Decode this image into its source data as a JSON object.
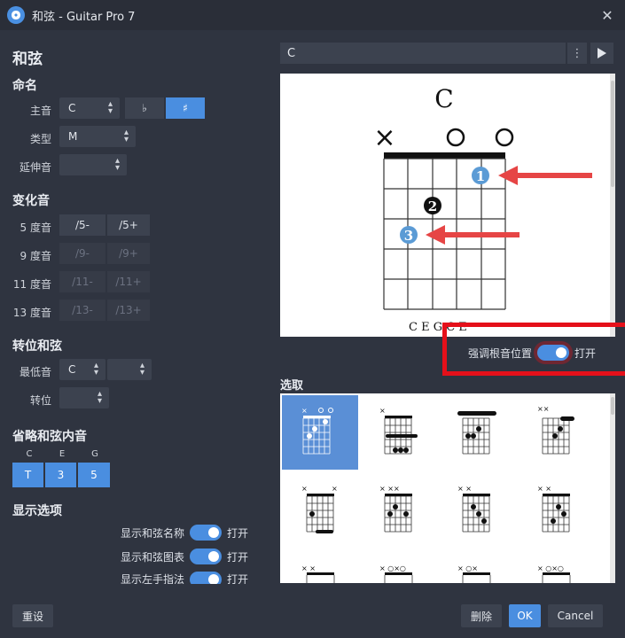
{
  "window": {
    "title": "和弦 - Guitar Pro 7",
    "close_glyph": "✕"
  },
  "left": {
    "heading": "和弦",
    "naming": {
      "title": "命名",
      "root_label": "主音",
      "root_value": "C",
      "flat": "♭",
      "sharp": "♯",
      "type_label": "类型",
      "type_value": "M",
      "ext_label": "延伸音",
      "ext_value": ""
    },
    "alter": {
      "title": "变化音",
      "rows": [
        {
          "label": "5 度音",
          "a": "/5-",
          "b": "/5+"
        },
        {
          "label": "9 度音",
          "a": "/9-",
          "b": "/9+"
        },
        {
          "label": "11 度音",
          "a": "/11-",
          "b": "/11+"
        },
        {
          "label": "13 度音",
          "a": "/13-",
          "b": "/13+"
        }
      ]
    },
    "inversion": {
      "title": "转位和弦",
      "bass_label": "最低音",
      "bass_value": "C",
      "bass_extra": "",
      "inv_label": "转位",
      "inv_value": ""
    },
    "omit": {
      "title": "省略和弦内音",
      "notes": [
        "C",
        "E",
        "G"
      ],
      "buttons": [
        "T",
        "3",
        "5"
      ]
    },
    "display": {
      "title": "显示选项",
      "rows": [
        {
          "label": "显示和弦名称",
          "state": "打开"
        },
        {
          "label": "显示和弦图表",
          "state": "打开"
        },
        {
          "label": "显示左手指法",
          "state": "打开"
        }
      ]
    }
  },
  "right": {
    "chord_name": "C",
    "diagram": {
      "title": "C",
      "markers": [
        "×",
        "",
        "",
        "○",
        "",
        "○"
      ],
      "fingers": [
        "1",
        "2",
        "3"
      ],
      "bottom_notes": "C  E  G  C  E"
    },
    "emphasize_label": "强调根音位置",
    "emphasize_state": "打开",
    "select_title": "选取"
  },
  "footer": {
    "reset": "重设",
    "delete": "删除",
    "ok": "OK",
    "cancel": "Cancel"
  },
  "colors": {
    "accent": "#4a8ee0",
    "highlight": "#e5101a",
    "background": "#2f3440"
  }
}
